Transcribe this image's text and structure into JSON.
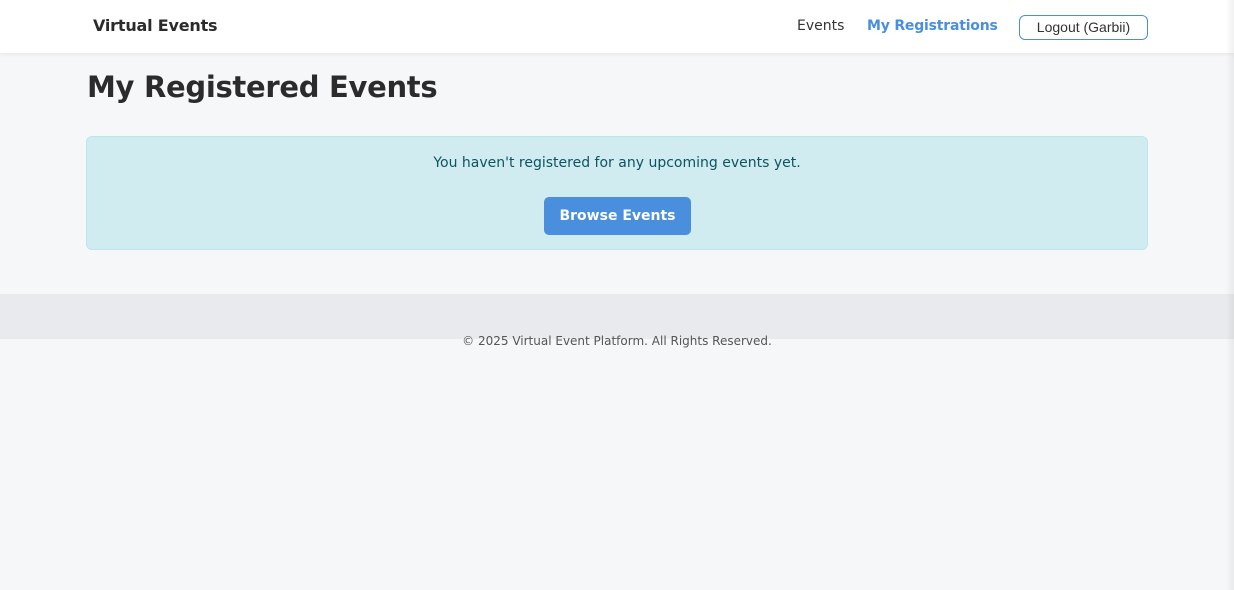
{
  "navbar": {
    "brand": "Virtual Events",
    "links": {
      "events": "Events",
      "my_registrations": "My Registrations"
    },
    "logout_label": "Logout (Garbii)"
  },
  "main": {
    "title": "My Registered Events",
    "alert": {
      "message": "You haven't registered for any upcoming events yet.",
      "button_label": "Browse Events"
    }
  },
  "footer": {
    "text": "© 2025 Virtual Event Platform. All Rights Reserved."
  },
  "colors": {
    "accent": "#4a8fdd",
    "alert_bg": "#d1ecf1",
    "alert_text": "#0c5460",
    "page_bg": "#f6f7f9",
    "footer_bg": "#e8eaed"
  }
}
